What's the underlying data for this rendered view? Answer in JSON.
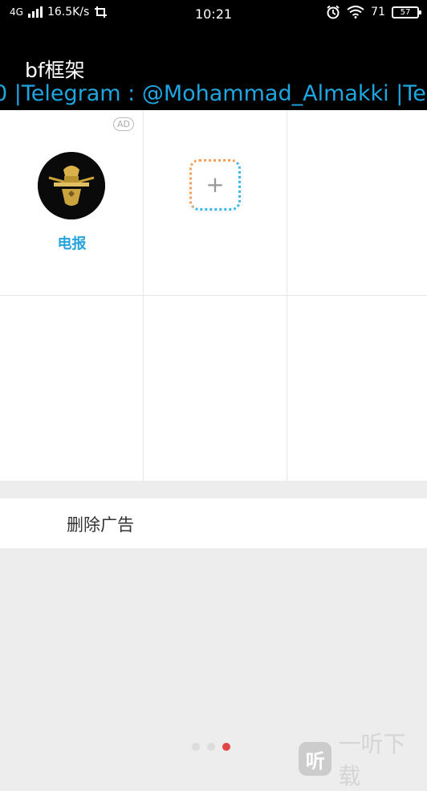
{
  "status_bar": {
    "network": "4G",
    "speed": "16.5K/s",
    "time": "10:21",
    "battery_level": "71",
    "battery_box": "57"
  },
  "app": {
    "title": "bf框架",
    "marquee": "0 |Telegram : @Mohammad_Almakki |Tel"
  },
  "grid": {
    "ad_badge": "AD",
    "tile_label": "电报",
    "add_symbol": "+"
  },
  "menu": {
    "remove_ads": "删除广告"
  },
  "watermark": {
    "icon_char": "听",
    "text": "一听下载"
  },
  "pager": {
    "count": 3,
    "active_index": 2
  },
  "colors": {
    "accent_blue": "#1fa6e0",
    "label_blue": "#29a3dc",
    "active_dot": "#e04646"
  },
  "icons": [
    "signal-icon",
    "screenshot-icon",
    "alarm-icon",
    "wifi-icon",
    "battery-icon",
    "add-icon"
  ]
}
